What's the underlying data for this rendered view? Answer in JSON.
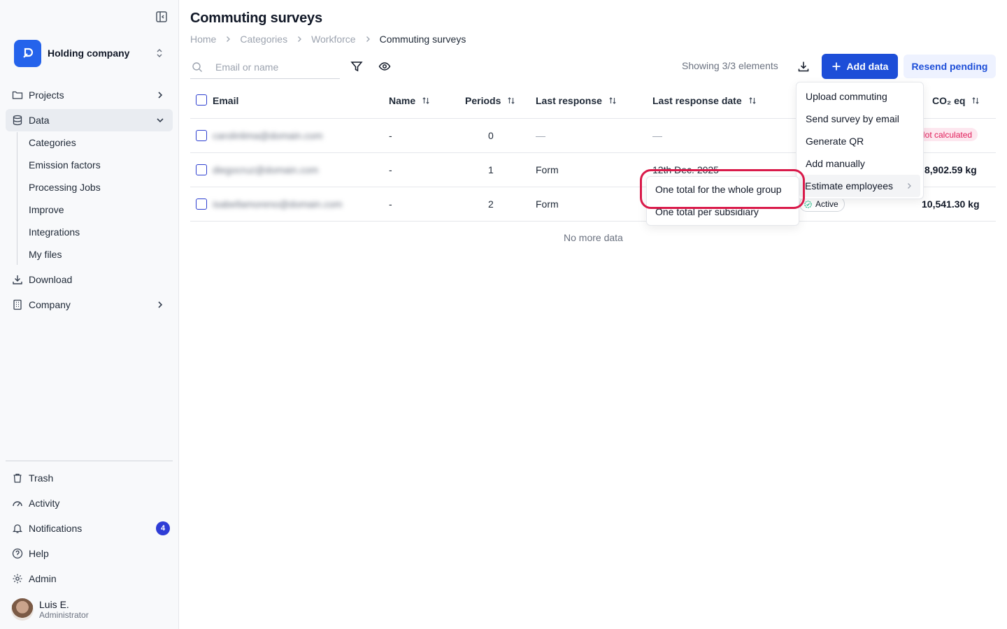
{
  "org": {
    "name": "Holding company"
  },
  "nav": {
    "projects": "Projects",
    "data": "Data",
    "sub": [
      "Categories",
      "Emission factors",
      "Processing Jobs",
      "Improve",
      "Integrations",
      "My files"
    ],
    "download": "Download",
    "company": "Company",
    "trash": "Trash",
    "activity": "Activity",
    "notifications": "Notifications",
    "notifications_count": "4",
    "help": "Help",
    "admin": "Admin"
  },
  "user": {
    "name": "Luis E.",
    "role": "Administrator"
  },
  "page": {
    "title": "Commuting surveys",
    "breadcrumb": [
      "Home",
      "Categories",
      "Workforce",
      "Commuting surveys"
    ]
  },
  "toolbar": {
    "search_placeholder": "Email or name",
    "showing": "Showing 3/3 elements",
    "add_data": "Add data",
    "resend_pending": "Resend pending"
  },
  "table": {
    "columns": [
      "Email",
      "Name",
      "Periods",
      "Last response",
      "Last response date",
      "CO₂ eq"
    ],
    "rows": [
      {
        "email": "carolinlima@domain.com",
        "name": "-",
        "periods": "0",
        "last_response": "—",
        "last_response_date": "—",
        "status": "Not calculated",
        "co2": ""
      },
      {
        "email": "diegocruz@domain.com",
        "name": "-",
        "periods": "1",
        "last_response": "Form",
        "last_response_date": "12th Dec. 2025",
        "status": "",
        "co2": "8,902.59 kg"
      },
      {
        "email": "isabellamoreno@domain.com",
        "name": "-",
        "periods": "2",
        "last_response": "Form",
        "last_response_date": "",
        "status": "Active",
        "co2": "10,541.30 kg"
      }
    ],
    "footer": "No more data"
  },
  "add_menu": {
    "items": [
      "Upload commuting",
      "Send survey by email",
      "Generate QR",
      "Add manually",
      "Estimate employees"
    ]
  },
  "estimate_submenu": {
    "items": [
      "One total for the whole group",
      "One total per subsidiary"
    ]
  },
  "colors": {
    "primary": "#1d4ed8",
    "highlight": "#d91a4a",
    "badge": "#2f3dd6"
  }
}
